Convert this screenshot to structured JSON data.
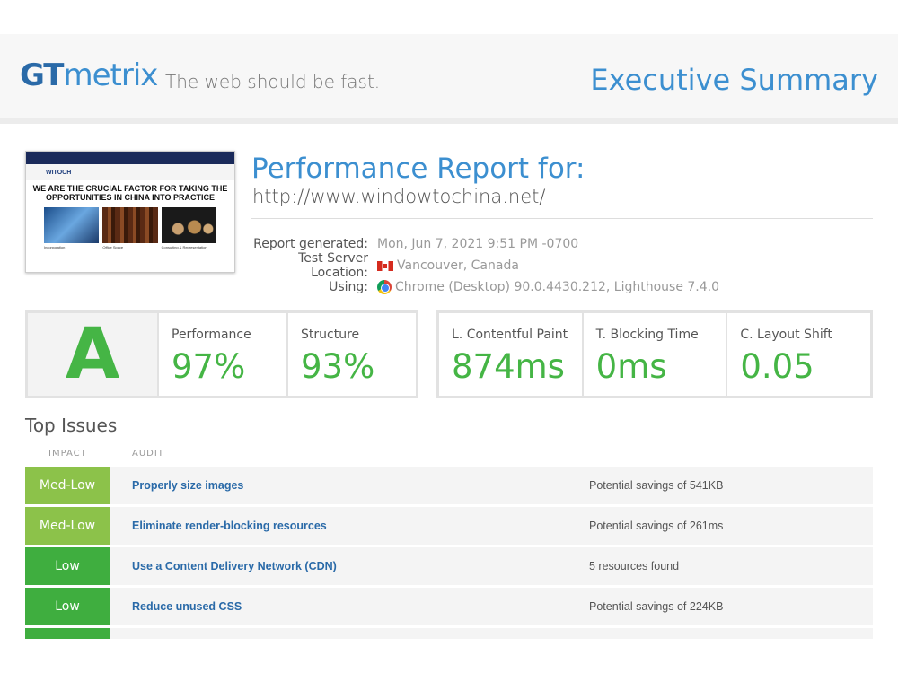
{
  "header": {
    "logo_gt": "GT",
    "logo_metrix": "metrix",
    "tagline": "The web should be fast.",
    "title": "Executive Summary"
  },
  "thumbnail": {
    "logo": "WITOCH",
    "headline": "WE ARE THE CRUCIAL FACTOR FOR TAKING THE OPPORTUNITIES IN CHINA INTO PRACTICE",
    "captions": [
      "Incorporation",
      "Office Space",
      "Consulting & Representation"
    ]
  },
  "report": {
    "title": "Performance Report for:",
    "url": "http://www.windowtochina.net/",
    "generated_label": "Report generated:",
    "generated_value": "Mon, Jun 7, 2021 9:51 PM -0700",
    "location_label": "Test Server Location:",
    "location_value": "Vancouver, Canada",
    "using_label": "Using:",
    "using_value": "Chrome (Desktop) 90.0.4430.212, Lighthouse 7.4.0"
  },
  "scores": {
    "grade": "A",
    "performance_label": "Performance",
    "performance_value": "97%",
    "structure_label": "Structure",
    "structure_value": "93%",
    "lcp_label": "L. Contentful Paint",
    "lcp_value": "874ms",
    "tbt_label": "T. Blocking Time",
    "tbt_value": "0ms",
    "cls_label": "C. Layout Shift",
    "cls_value": "0.05"
  },
  "issues": {
    "title": "Top Issues",
    "col_impact": "IMPACT",
    "col_audit": "AUDIT",
    "rows": [
      {
        "impact": "Med-Low",
        "audit": "Properly size images",
        "detail": "Potential savings of 541KB"
      },
      {
        "impact": "Med-Low",
        "audit": "Eliminate render-blocking resources",
        "detail": "Potential savings of 261ms"
      },
      {
        "impact": "Low",
        "audit": "Use a Content Delivery Network (CDN)",
        "detail": "5 resources found"
      },
      {
        "impact": "Low",
        "audit": "Reduce unused CSS",
        "detail": "Potential savings of 224KB"
      }
    ]
  },
  "colors": {
    "brand_blue": "#3c8fd0",
    "grade_green": "#45b545",
    "med_low": "#8cc24a",
    "low": "#3fae3f"
  }
}
